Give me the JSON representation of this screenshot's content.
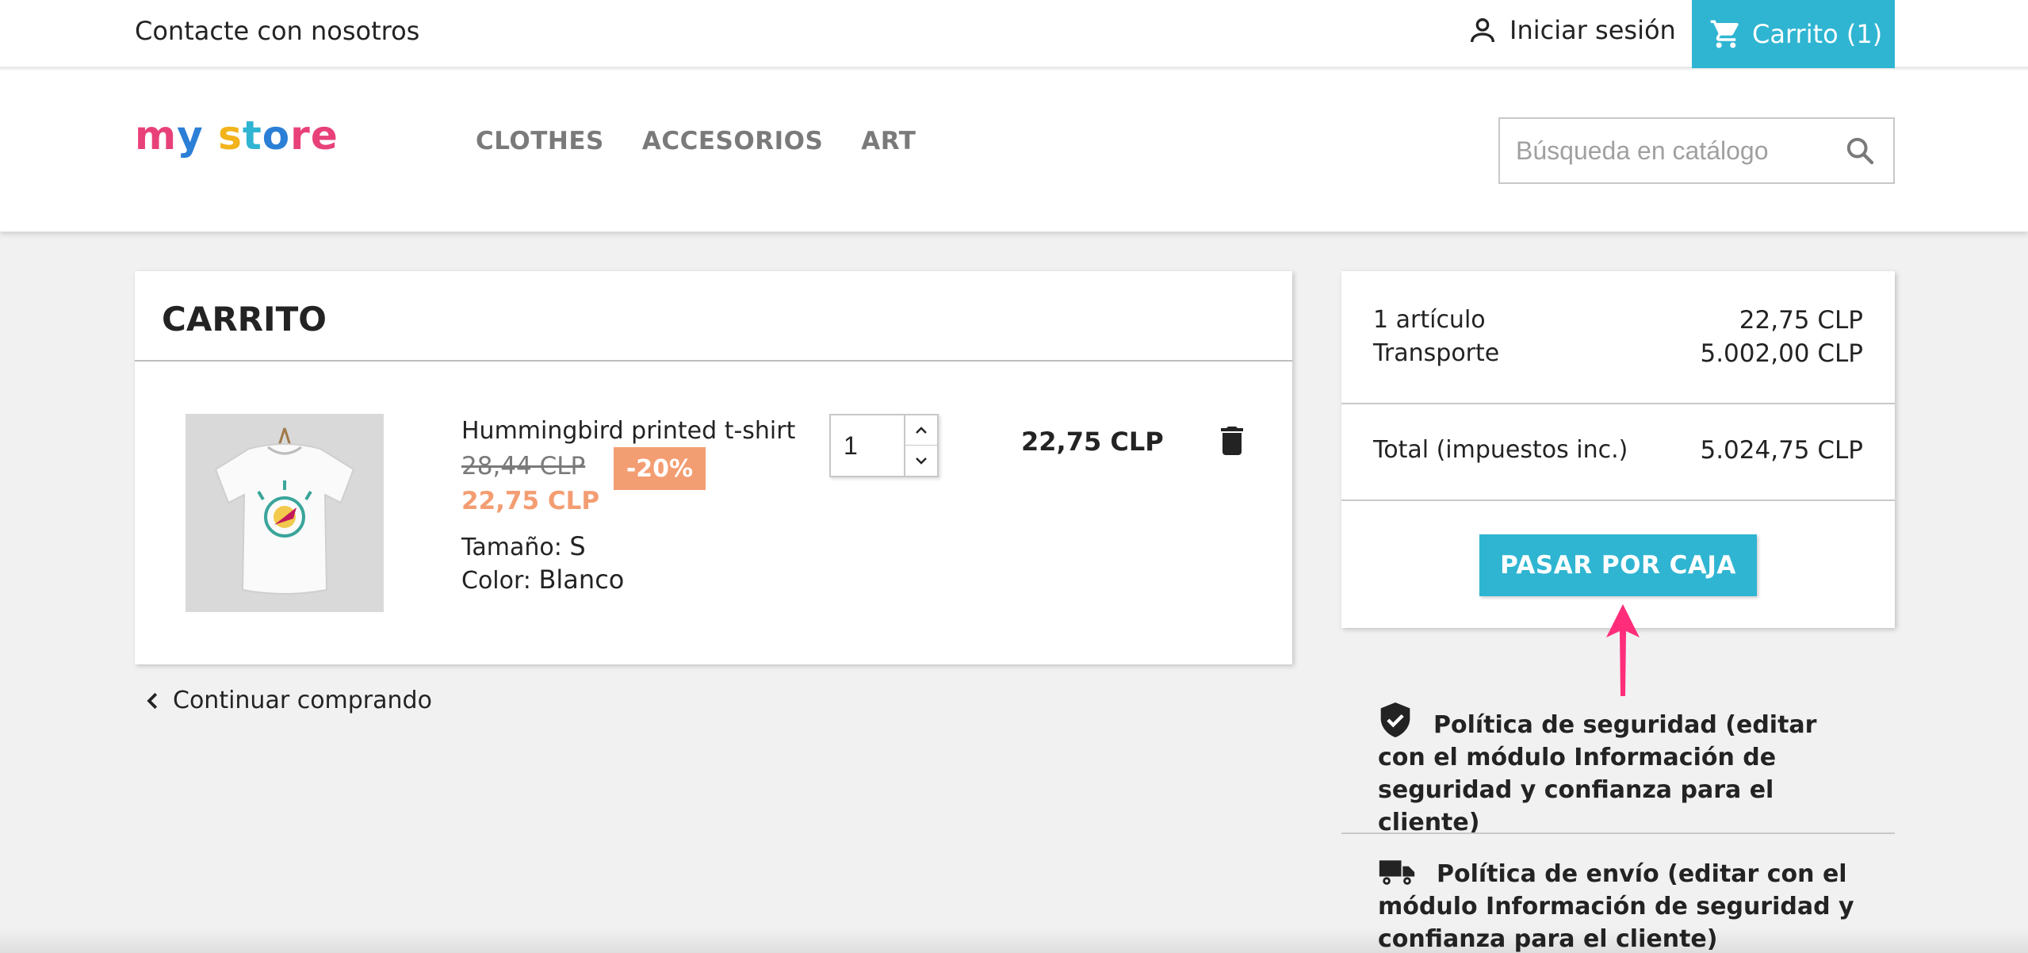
{
  "topbar": {
    "contact_label": "Contacte con nosotros",
    "signin_label": "Iniciar sesión",
    "cart_label": "Carrito (1)"
  },
  "header": {
    "logo_text": "my store",
    "menu": [
      "CLOTHES",
      "ACCESORIOS",
      "ART"
    ],
    "search_placeholder": "Búsqueda en catálogo"
  },
  "cart": {
    "title": "CARRITO",
    "item": {
      "name": "Hummingbird printed t-shirt",
      "regular_price": "28,44 CLP",
      "discount": "-20%",
      "price": "22,75 CLP",
      "size_label": "Tamaño:",
      "size_value": "S",
      "color_label": "Color:",
      "color_value": "Blanco",
      "quantity": "1",
      "line_total": "22,75 CLP"
    },
    "continue_label": "Continuar comprando"
  },
  "summary": {
    "items_label": "1 artículo",
    "items_value": "22,75 CLP",
    "shipping_label": "Transporte",
    "shipping_value": "5.002,00 CLP",
    "total_label": "Total (impuestos inc.)",
    "total_value": "5.024,75 CLP",
    "checkout_label": "PASAR POR CAJA"
  },
  "reassurance": [
    {
      "icon": "shield-check-icon",
      "text": "Política de seguridad (editar con el módulo Información de seguridad y confianza para el cliente)"
    },
    {
      "icon": "truck-icon",
      "text": "Política de envío (editar con el módulo Información de seguridad y confianza para el cliente)"
    }
  ],
  "colors": {
    "accent": "#2fb5d2",
    "discount": "#f39d72",
    "annotation_arrow": "#ff2d7a"
  }
}
